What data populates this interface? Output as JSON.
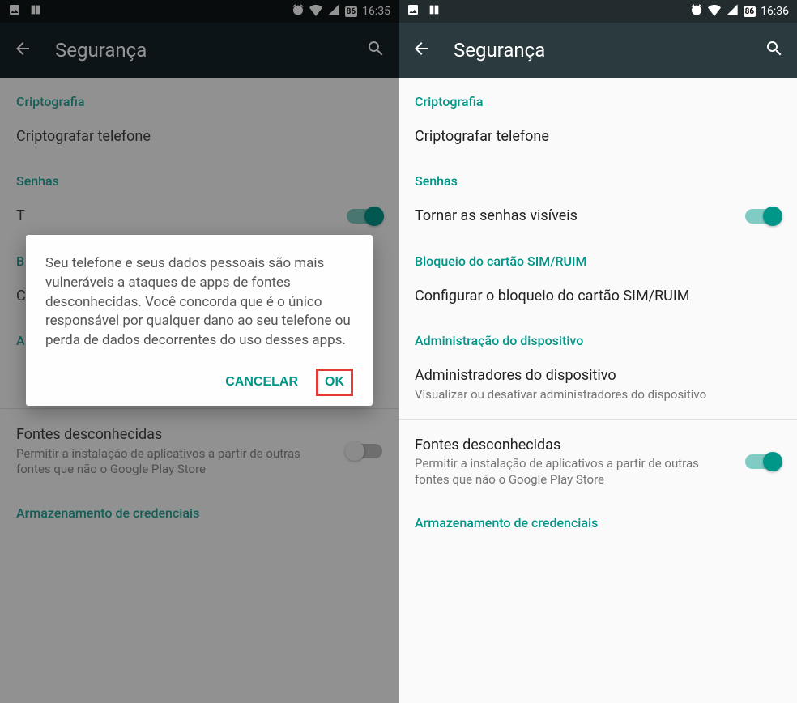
{
  "left": {
    "status": {
      "battery": "86",
      "time": "16:35"
    },
    "header": {
      "title": "Segurança"
    },
    "sections": {
      "crypto": {
        "header": "Criptografia",
        "item": "Criptografar telefone"
      },
      "passwords": {
        "header": "Senhas",
        "item_partial": "T"
      },
      "block": {
        "header_partial": "B",
        "item_partial": "C"
      },
      "admin_partial": "A",
      "unknown": {
        "title": "Fontes desconhecidas",
        "subtitle": "Permitir a instalação de aplicativos a partir de outras fontes que não o Google Play Store"
      },
      "creds": {
        "header": "Armazenamento de credenciais"
      }
    },
    "dialog": {
      "text": "Seu telefone e seus dados pessoais são mais vulneráveis a ataques de apps de fontes desconhecidas. Você concorda que é o único responsável por qualquer dano ao seu telefone ou perda de dados decorrentes do uso desses apps.",
      "cancel": "CANCELAR",
      "ok": "OK"
    }
  },
  "right": {
    "status": {
      "battery": "86",
      "time": "16:36"
    },
    "header": {
      "title": "Segurança"
    },
    "sections": {
      "crypto": {
        "header": "Criptografia",
        "item": "Criptografar telefone"
      },
      "passwords": {
        "header": "Senhas",
        "item": "Tornar as senhas visíveis"
      },
      "sim": {
        "header": "Bloqueio do cartão SIM/RUIM",
        "item": "Configurar o bloqueio do cartão SIM/RUIM"
      },
      "admin": {
        "header": "Administração do dispositivo",
        "item1_title": "Administradores do dispositivo",
        "item1_sub": "Visualizar ou desativar administradores do dispositivo",
        "item2_title": "Fontes desconhecidas",
        "item2_sub": "Permitir a instalação de aplicativos a partir de outras fontes que não o Google Play Store"
      },
      "creds": {
        "header": "Armazenamento de credenciais"
      }
    }
  }
}
